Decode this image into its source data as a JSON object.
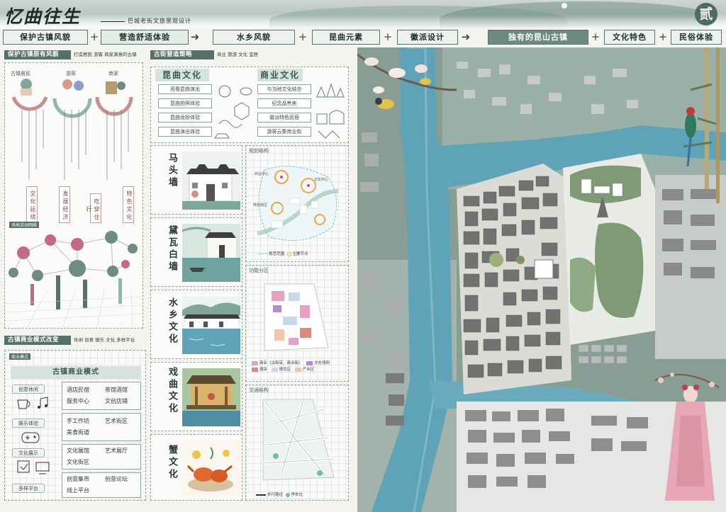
{
  "header": {
    "title": "忆曲往生",
    "subtitle": "巴城老街文旅景观设计",
    "seal": "贰"
  },
  "nav": {
    "items": [
      {
        "label": "保护古镇风貌"
      },
      {
        "label": "营造舒适体验"
      },
      {
        "label": "水乡风貌"
      },
      {
        "label": "昆曲元素"
      },
      {
        "label": "徽派设计"
      },
      {
        "label": "独有的昆山古镇"
      },
      {
        "label": "文化特色"
      },
      {
        "label": "民俗体验"
      }
    ],
    "plus": "+",
    "arrow": "➜"
  },
  "section1": {
    "heading": "保护古镇原有风貌",
    "note": "打造居民 游客 商家满意的古镇",
    "top_labels": [
      "古镇居民",
      "游客",
      "商家"
    ],
    "branch_labels": [
      "文化延续",
      "发展经济",
      "特色文化",
      "吃穿住行"
    ],
    "network_label": "场地活动网络"
  },
  "section2": {
    "heading": "古街营造策略",
    "note": "商业 旅游 文化 宜居",
    "kunqu": {
      "title": "昆曲文化",
      "items": [
        "观看昆曲演出",
        "昆曲拍照体验",
        "昆曲妆扮体验",
        "昆曲演出体验"
      ]
    },
    "commerce": {
      "title": "商业文化",
      "items": [
        "与当地文化结合",
        "纪念品售卖",
        "徽派特色民宿",
        "游客云集商业街"
      ]
    }
  },
  "culture_cards": [
    {
      "title": "马头墙"
    },
    {
      "title": "黛瓦白墙"
    },
    {
      "title": "水乡文化"
    },
    {
      "title": "戏曲文化"
    },
    {
      "title": "蟹文化"
    }
  ],
  "analysis": {
    "planning": {
      "title": "规划结构",
      "labels": [
        "商业中心",
        "文化中心",
        "特色街区"
      ],
      "legend": [
        "规范范围",
        "主要节点"
      ]
    },
    "function": {
      "title": "功能分区",
      "legend": [
        {
          "label": "商业（古街店、商业街）",
          "color": "#e6a0c4"
        },
        {
          "label": "文化场所",
          "color": "#b58bd0"
        },
        {
          "label": "酒店",
          "color": "#d98b7c"
        },
        {
          "label": "居住区",
          "color": "#c9d9e9"
        },
        {
          "label": "产业区",
          "color": "#f2c6a6"
        }
      ]
    },
    "traffic": {
      "title": "交通结构",
      "legend": [
        "步行路径",
        "停车位"
      ]
    }
  },
  "section3": {
    "heading": "古镇商业模式改变",
    "note": "休闲 创意 娱乐 文化 多样平台",
    "panel_label": "商业模式",
    "table_title": "古镇商业模式",
    "rows": [
      {
        "label": "创意休闲",
        "cells": [
          "酒店民宿",
          "茶馆酒馆",
          "服务中心",
          "文创店铺"
        ]
      },
      {
        "label": "娱乐体验",
        "cells": [
          "手工作坊",
          "艺术街区",
          "美食街道",
          ""
        ]
      },
      {
        "label": "文化展示",
        "cells": [
          "文化展馆",
          "艺术展厅",
          "文化街区",
          ""
        ]
      },
      {
        "label": "多样平台",
        "cells": [
          "创意集市",
          "创意论坛",
          "线上平台",
          ""
        ]
      }
    ]
  },
  "colors": {
    "accent": "#56716a",
    "water": "#5fa3b8",
    "building": "#6d6d6d",
    "pink": "#e7a7b6"
  }
}
